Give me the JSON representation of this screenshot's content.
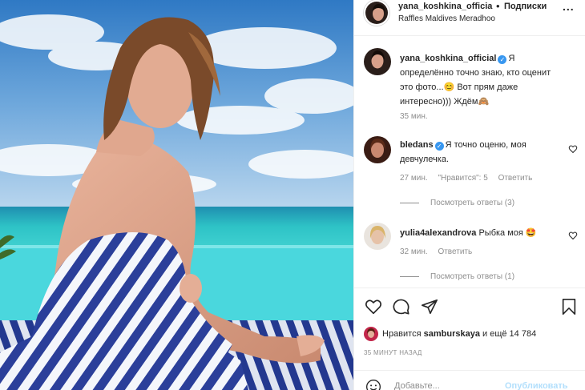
{
  "post": {
    "header": {
      "username": "yana_koshkina_officia",
      "dot": "•",
      "follow_label": "Подписки",
      "more_label": "...",
      "location": "Raffles Maldives Meradhoo"
    },
    "caption": {
      "username": "yana_koshkina_official",
      "text": "Я определённо точно знаю, кто оценит это фото...😊 Вот прям даже интересно))) Ждём🙈",
      "time": "35 мин."
    },
    "comments": [
      {
        "username": "bledans",
        "verified": true,
        "text": "Я точно оценю, моя девчулечка.",
        "time": "27 мин.",
        "likes_label": "\"Нравится\": 5",
        "reply_label": "Ответить",
        "view_replies": "Посмотреть ответы (3)"
      },
      {
        "username": "yulia4alexandrova",
        "verified": false,
        "text": "Рыбка моя 🤩",
        "time": "32 мин.",
        "reply_label": "Ответить",
        "view_replies": "Посмотреть ответы (1)"
      }
    ],
    "likes": {
      "prefix": "Нравится",
      "liker": "samburskaya",
      "suffix": "и ещё 14 784"
    },
    "time_ago": "35 МИНУТ НАЗАД",
    "add_comment": {
      "placeholder": "Добавьте...",
      "publish_label": "Опубликовать"
    },
    "colors": {
      "verified": "#3897f0",
      "publish_disabled": "#b2dffc",
      "muted": "#8e8e8e"
    }
  }
}
